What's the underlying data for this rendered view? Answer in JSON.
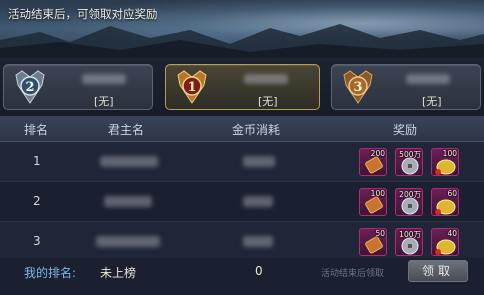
{
  "banner": {
    "text": "活动结束后，可领取对应奖励"
  },
  "podium": [
    {
      "rank": "2",
      "value": "[无]",
      "medal": "silver-medal-icon"
    },
    {
      "rank": "1",
      "value": "[无]",
      "medal": "gold-medal-icon"
    },
    {
      "rank": "3",
      "value": "[无]",
      "medal": "bronze-medal-icon"
    }
  ],
  "table": {
    "headers": [
      "排名",
      "君主名",
      "金币消耗",
      "奖励"
    ],
    "rows": [
      {
        "rank": "1",
        "rewards": [
          "200",
          "500万",
          "100"
        ]
      },
      {
        "rank": "2",
        "rewards": [
          "100",
          "200万",
          "60"
        ]
      },
      {
        "rank": "3",
        "rewards": [
          "50",
          "100万",
          "40"
        ]
      }
    ]
  },
  "footer": {
    "my_rank_label": "我的排名:",
    "my_rank_value": "未上榜",
    "my_gold": "0",
    "hint": "活动结束后领取",
    "claim_label": "领取"
  },
  "reward_icons": [
    "scroll-icon",
    "silver-coin-icon",
    "gold-ingot-icon"
  ],
  "colors": {
    "accent_blue": "#7fb6e8",
    "reward_border": "#b02a78",
    "gold_card_border": "#b89b55"
  }
}
